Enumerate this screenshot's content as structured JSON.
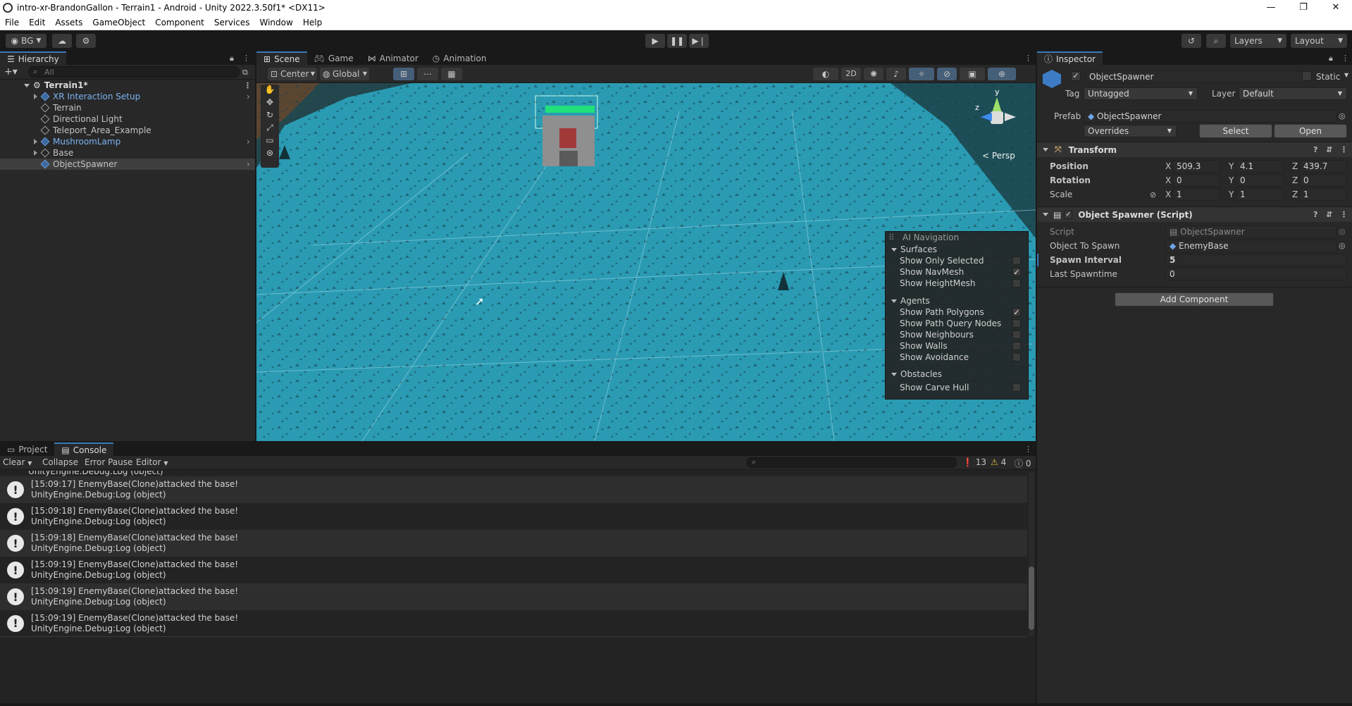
{
  "window": {
    "title": "intro-xr-BrandonGallon - Terrain1 - Android - Unity 2022.3.50f1* <DX11>",
    "controls": [
      "—",
      "❐",
      "✕"
    ]
  },
  "menu": [
    "File",
    "Edit",
    "Assets",
    "GameObject",
    "Component",
    "Services",
    "Window",
    "Help"
  ],
  "toolbar": {
    "account": "BG",
    "layers": "Layers",
    "layout": "Layout"
  },
  "hierarchy": {
    "tab": "Hierarchy",
    "search_placeholder": "All",
    "scene": "Terrain1*",
    "items": [
      {
        "label": "XR Interaction Setup"
      },
      {
        "label": "Terrain"
      },
      {
        "label": "Directional Light"
      },
      {
        "label": "Teleport_Area_Example"
      },
      {
        "label": "MushroomLamp"
      },
      {
        "label": "Base"
      },
      {
        "label": "ObjectSpawner"
      }
    ]
  },
  "scene_tabs": [
    "Scene",
    "Game",
    "Animator",
    "Animation"
  ],
  "scene_toolbar": {
    "pivot": "Center",
    "space": "Global",
    "mode_2d": "2D",
    "persp": "< Persp"
  },
  "gizmo": {
    "y": "y",
    "z": "z"
  },
  "ai_navigation": {
    "title": "AI Navigation",
    "sections": [
      {
        "name": "Surfaces",
        "items": [
          {
            "label": "Show Only Selected",
            "checked": false
          },
          {
            "label": "Show NavMesh",
            "checked": true
          },
          {
            "label": "Show HeightMesh",
            "checked": false
          }
        ]
      },
      {
        "name": "Agents",
        "items": [
          {
            "label": "Show Path Polygons",
            "checked": true
          },
          {
            "label": "Show Path Query Nodes",
            "checked": false
          },
          {
            "label": "Show Neighbours",
            "checked": false
          },
          {
            "label": "Show Walls",
            "checked": false
          },
          {
            "label": "Show Avoidance",
            "checked": false
          }
        ]
      },
      {
        "name": "Obstacles",
        "items": [
          {
            "label": "Show Carve Hull",
            "checked": false
          }
        ]
      }
    ],
    "check_mark": "✓"
  },
  "bottom_tabs": [
    "Project",
    "Console"
  ],
  "console": {
    "clear": "Clear",
    "collapse": "Collapse",
    "error_pause": "Error Pause",
    "editor": "Editor",
    "count_info": "13",
    "count_warn": "4",
    "count_err": "0",
    "partial_line": "UnityEngine.Debug:Log (object)",
    "entries": [
      {
        "line1": "[15:09:17] EnemyBase(Clone)attacked the base!",
        "line2": "UnityEngine.Debug:Log (object)"
      },
      {
        "line1": "[15:09:18] EnemyBase(Clone)attacked the base!",
        "line2": "UnityEngine.Debug:Log (object)"
      },
      {
        "line1": "[15:09:18] EnemyBase(Clone)attacked the base!",
        "line2": "UnityEngine.Debug:Log (object)"
      },
      {
        "line1": "[15:09:19] EnemyBase(Clone)attacked the base!",
        "line2": "UnityEngine.Debug:Log (object)"
      },
      {
        "line1": "[15:09:19] EnemyBase(Clone)attacked the base!",
        "line2": "UnityEngine.Debug:Log (object)"
      },
      {
        "line1": "[15:09:19] EnemyBase(Clone)attacked the base!",
        "line2": "UnityEngine.Debug:Log (object)"
      }
    ]
  },
  "inspector": {
    "tab": "Inspector",
    "object_name": "ObjectSpawner",
    "static_label": "Static",
    "tag_label": "Tag",
    "tag_value": "Untagged",
    "layer_label": "Layer",
    "layer_value": "Default",
    "prefab_label": "Prefab",
    "prefab_value": "ObjectSpawner",
    "overrides": "Overrides",
    "select": "Select",
    "open": "Open",
    "transform": {
      "title": "Transform",
      "position_label": "Position",
      "rotation_label": "Rotation",
      "scale_label": "Scale",
      "position": {
        "x": "509.3",
        "y": "4.1",
        "z": "439.7"
      },
      "rotation": {
        "x": "0",
        "y": "0",
        "z": "0"
      },
      "scale": {
        "x": "1",
        "y": "1",
        "z": "1"
      },
      "axis_x": "X",
      "axis_y": "Y",
      "axis_z": "Z"
    },
    "script_component": {
      "title": "Object Spawner (Script)",
      "script_label": "Script",
      "script_value": "ObjectSpawner",
      "object_to_spawn_label": "Object To Spawn",
      "object_to_spawn_value": "EnemyBase",
      "spawn_interval_label": "Spawn Interval",
      "spawn_interval_value": "5",
      "last_spawntime_label": "Last Spawntime",
      "last_spawntime_value": "0"
    },
    "add_component": "Add Component"
  },
  "colors": {
    "accent": "#3a79bb",
    "terrain": "#2a9bb3",
    "selection": "#2c5d87"
  }
}
